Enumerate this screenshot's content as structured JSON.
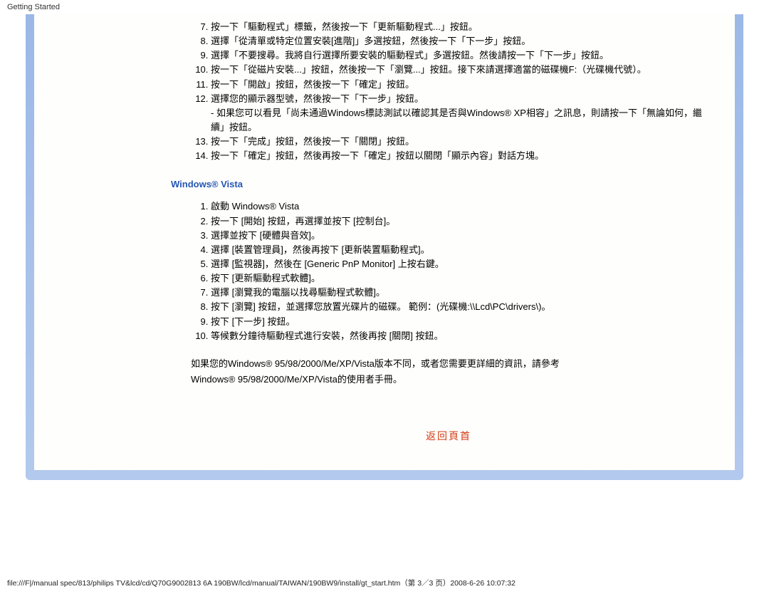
{
  "header": {
    "title": "Getting Started"
  },
  "xp_steps": [
    "按一下「驅動程式」標籤，然後按一下「更新驅動程式...」按鈕。",
    "選擇「從清單或特定位置安裝[進階]」多選按鈕，然後按一下「下一步」按鈕。",
    "選擇「不要搜尋。我將自行選擇所要安裝的驅動程式」多選按鈕。然後請按一下「下一步」按鈕。",
    "按一下「從磁片安裝...」按鈕，然後按一下「瀏覽...」按鈕。接下來請選擇適當的磁碟機F:（光碟機代號）。",
    "按一下「開啟」按鈕，然後按一下「確定」按鈕。",
    "選擇您的顯示器型號，然後按一下「下一步」按鈕。\n- 如果您可以看見「尚未通過Windows標誌測試以確認其是否與Windows® XP相容」之訊息，則請按一下「無論如何，繼續」按鈕。",
    "按一下「完成」按鈕，然後按一下「關閉」按鈕。",
    "按一下「確定」按鈕，然後再按一下「確定」按鈕以關閉「顯示內容」對話方塊。"
  ],
  "xp_start": 7,
  "vista_heading": "Windows® Vista",
  "vista_steps": [
    "啟動 Windows® Vista",
    "按一下 [開始] 按鈕，再選擇並按下 [控制台]。",
    "選擇並按下 [硬體與音效]。",
    "選擇 [裝置管理員]，然後再按下 [更新裝置驅動程式]。",
    "選擇 [監視器]，然後在 [Generic PnP Monitor] 上按右鍵。",
    "按下 [更新驅動程式軟體]。",
    "選擇 [瀏覽我的電腦以找尋驅動程式軟體]。",
    "按下 [瀏覽] 按鈕，並選擇您放置光碟片的磁碟。  範例：(光碟機:\\\\Lcd\\PC\\drivers\\)。",
    "按下 [下一步] 按鈕。",
    "等候數分鐘待驅動程式進行安裝，然後再按 [關閉] 按鈕。"
  ],
  "footnote": {
    "line1": "如果您的Windows® 95/98/2000/Me/XP/Vista版本不同，或者您需要更詳細的資訊，請參考",
    "line2": "Windows® 95/98/2000/Me/XP/Vista的使用者手冊。"
  },
  "return_text": "返回頁首",
  "footer_path": "file:///F|/manual spec/813/philips TV&lcd/cd/Q70G9002813 6A 190BW/lcd/manual/TAIWAN/190BW9/install/gt_start.htm（第 3／3 页）2008-6-26 10:07:32"
}
